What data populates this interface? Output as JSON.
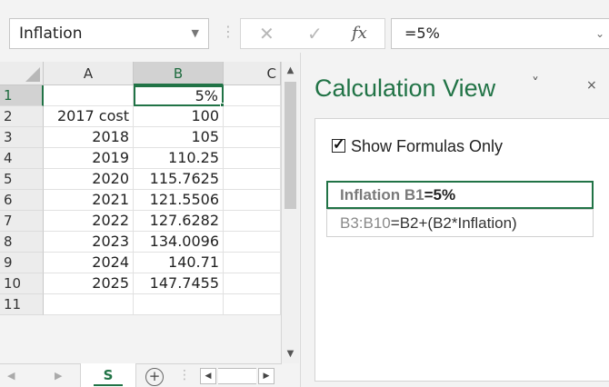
{
  "formula_bar": {
    "name_box": "Inflation",
    "formula": "=5%",
    "separator": "⋮",
    "cancel_glyph": "✕",
    "enter_glyph": "✓",
    "fx_label": "fx",
    "dropdown_glyph": "▼",
    "formula_dropdown_glyph": "⌄"
  },
  "grid": {
    "corner_icon": "select-all-triangle",
    "columns": [
      "A",
      "B",
      "C"
    ],
    "selected_column": "B",
    "rows": [
      {
        "n": "1",
        "a": "",
        "b": "5%"
      },
      {
        "n": "2",
        "a": "2017 cost",
        "b": "100"
      },
      {
        "n": "3",
        "a": "2018",
        "b": "105"
      },
      {
        "n": "4",
        "a": "2019",
        "b": "110.25"
      },
      {
        "n": "5",
        "a": "2020",
        "b": "115.7625"
      },
      {
        "n": "6",
        "a": "2021",
        "b": "121.5506"
      },
      {
        "n": "7",
        "a": "2022",
        "b": "127.6282"
      },
      {
        "n": "8",
        "a": "2023",
        "b": "134.0096"
      },
      {
        "n": "9",
        "a": "2024",
        "b": "140.71"
      },
      {
        "n": "10",
        "a": "2025",
        "b": "147.7455"
      },
      {
        "n": "11",
        "a": "",
        "b": ""
      }
    ],
    "active_cell": "B1"
  },
  "scrollbar": {
    "up": "▲",
    "down": "▼"
  },
  "tabs": {
    "prev": "◀",
    "next": "▶",
    "sheet_label": "S",
    "add_sheet": "+",
    "dots": "⋮",
    "scroll_left": "◀",
    "scroll_right": "▶"
  },
  "pane": {
    "title": "Calculation View",
    "menu_glyph": "˅",
    "close_glyph": "×",
    "checkbox_label": "Show Formulas Only",
    "checkbox_checked": true,
    "formulas": [
      {
        "ref": "Inflation B1",
        "expr": "=5%",
        "selected": true
      },
      {
        "ref": "B3:B10",
        "expr": "=B2+(B2*Inflation)",
        "selected": false
      }
    ]
  },
  "colors": {
    "accent": "#217346",
    "header_bg": "#ececec",
    "selected_header_bg": "#d2d2d2"
  }
}
